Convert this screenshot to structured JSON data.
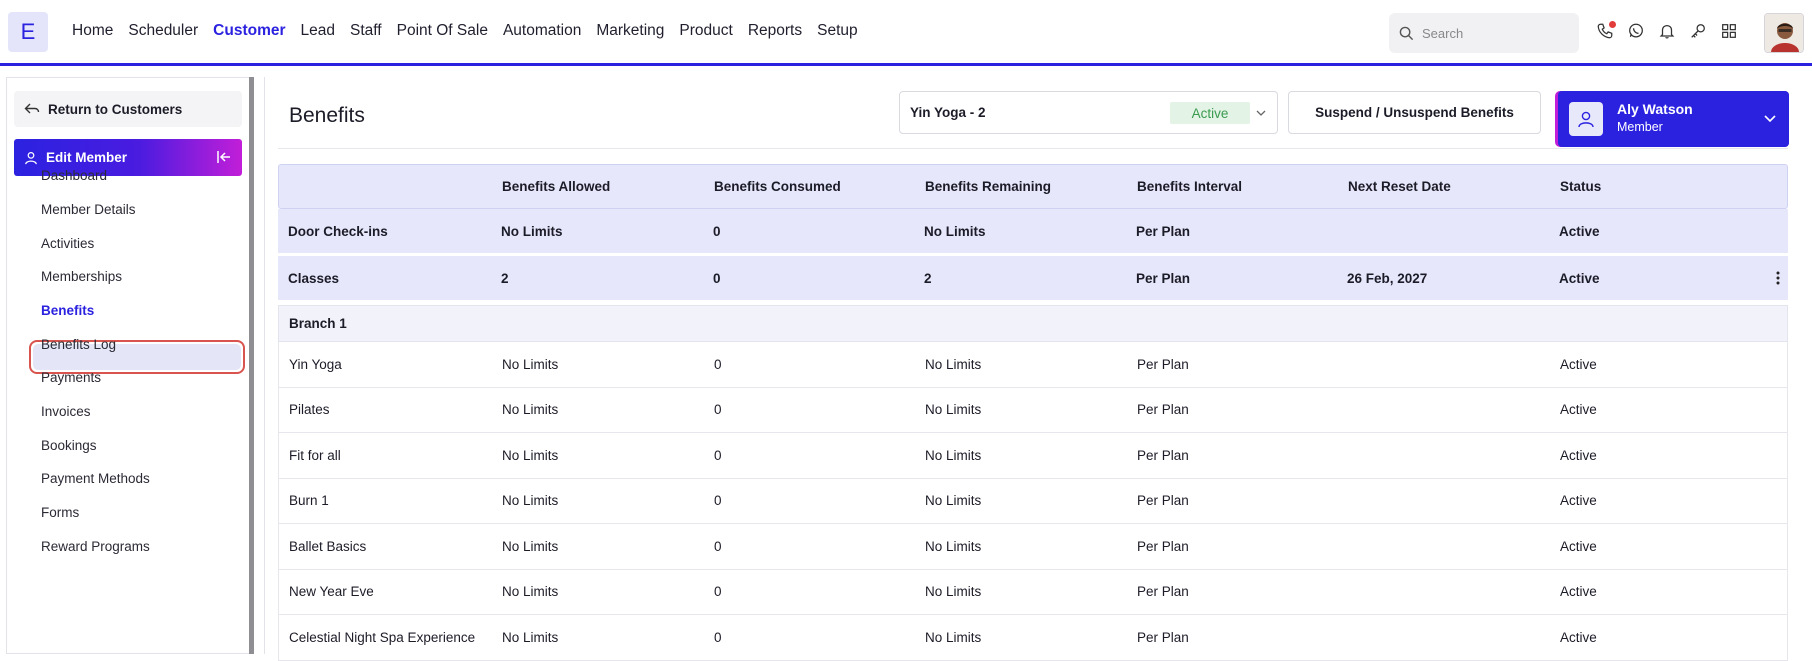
{
  "app": {
    "logo_letter": "E"
  },
  "nav": {
    "items": [
      {
        "label": "Home",
        "active": false
      },
      {
        "label": "Scheduler",
        "active": false
      },
      {
        "label": "Customer",
        "active": true
      },
      {
        "label": "Lead",
        "active": false
      },
      {
        "label": "Staff",
        "active": false
      },
      {
        "label": "Point Of Sale",
        "active": false
      },
      {
        "label": "Automation",
        "active": false
      },
      {
        "label": "Marketing",
        "active": false
      },
      {
        "label": "Product",
        "active": false
      },
      {
        "label": "Reports",
        "active": false
      },
      {
        "label": "Setup",
        "active": false
      }
    ]
  },
  "search": {
    "placeholder": "Search",
    "value": ""
  },
  "top_icons": [
    "phone-icon",
    "whatsapp-icon",
    "bell-icon",
    "key-icon",
    "apps-grid-icon"
  ],
  "sidebar": {
    "return_label": "Return to Customers",
    "edit_member_label": "Edit Member",
    "items": [
      {
        "label": "Dashboard"
      },
      {
        "label": "Member Details"
      },
      {
        "label": "Activities"
      },
      {
        "label": "Memberships"
      },
      {
        "label": "Benefits"
      },
      {
        "label": "Benefits Log"
      },
      {
        "label": "Payments"
      },
      {
        "label": "Invoices"
      },
      {
        "label": "Bookings"
      },
      {
        "label": "Payment Methods"
      },
      {
        "label": "Forms"
      },
      {
        "label": "Reward Programs"
      }
    ],
    "active_item": "Benefits"
  },
  "main": {
    "title": "Benefits",
    "plan_select": {
      "value": "Yin Yoga - 2",
      "badge": "Active"
    },
    "suspend_label": "Suspend / Unsuspend Benefits",
    "member": {
      "name": "Aly Watson",
      "role": "Member"
    }
  },
  "table": {
    "columns": [
      "",
      "Benefits Allowed",
      "Benefits Consumed",
      "Benefits Remaining",
      "Benefits Interval",
      "Next Reset Date",
      "Status"
    ],
    "summary_rows": [
      {
        "name": "Door Check-ins",
        "allowed": "No Limits",
        "consumed": "0",
        "remaining": "No Limits",
        "interval": "Per Plan",
        "reset": "",
        "status": "Active"
      },
      {
        "name": "Classes",
        "allowed": "2",
        "consumed": "0",
        "remaining": "2",
        "interval": "Per Plan",
        "reset": "26 Feb, 2027",
        "status": "Active"
      }
    ],
    "branch_label": "Branch 1",
    "rows": [
      {
        "name": "Yin Yoga",
        "allowed": "No Limits",
        "consumed": "0",
        "remaining": "No Limits",
        "interval": "Per Plan",
        "reset": "",
        "status": "Active"
      },
      {
        "name": "Pilates",
        "allowed": "No Limits",
        "consumed": "0",
        "remaining": "No Limits",
        "interval": "Per Plan",
        "reset": "",
        "status": "Active"
      },
      {
        "name": "Fit for all",
        "allowed": "No Limits",
        "consumed": "0",
        "remaining": "No Limits",
        "interval": "Per Plan",
        "reset": "",
        "status": "Active"
      },
      {
        "name": "Burn 1",
        "allowed": "No Limits",
        "consumed": "0",
        "remaining": "No Limits",
        "interval": "Per Plan",
        "reset": "",
        "status": "Active"
      },
      {
        "name": "Ballet Basics",
        "allowed": "No Limits",
        "consumed": "0",
        "remaining": "No Limits",
        "interval": "Per Plan",
        "reset": "",
        "status": "Active"
      },
      {
        "name": "New Year Eve",
        "allowed": "No Limits",
        "consumed": "0",
        "remaining": "No Limits",
        "interval": "Per Plan",
        "reset": "",
        "status": "Active"
      },
      {
        "name": "Celestial Night Spa Experience",
        "allowed": "No Limits",
        "consumed": "0",
        "remaining": "No Limits",
        "interval": "Per Plan",
        "reset": "",
        "status": "Active"
      }
    ]
  },
  "colors": {
    "accent": "#2b22e0",
    "magenta": "#c21ed8",
    "active_green": "#3a9a50",
    "header_bg": "#e6e7fb"
  }
}
